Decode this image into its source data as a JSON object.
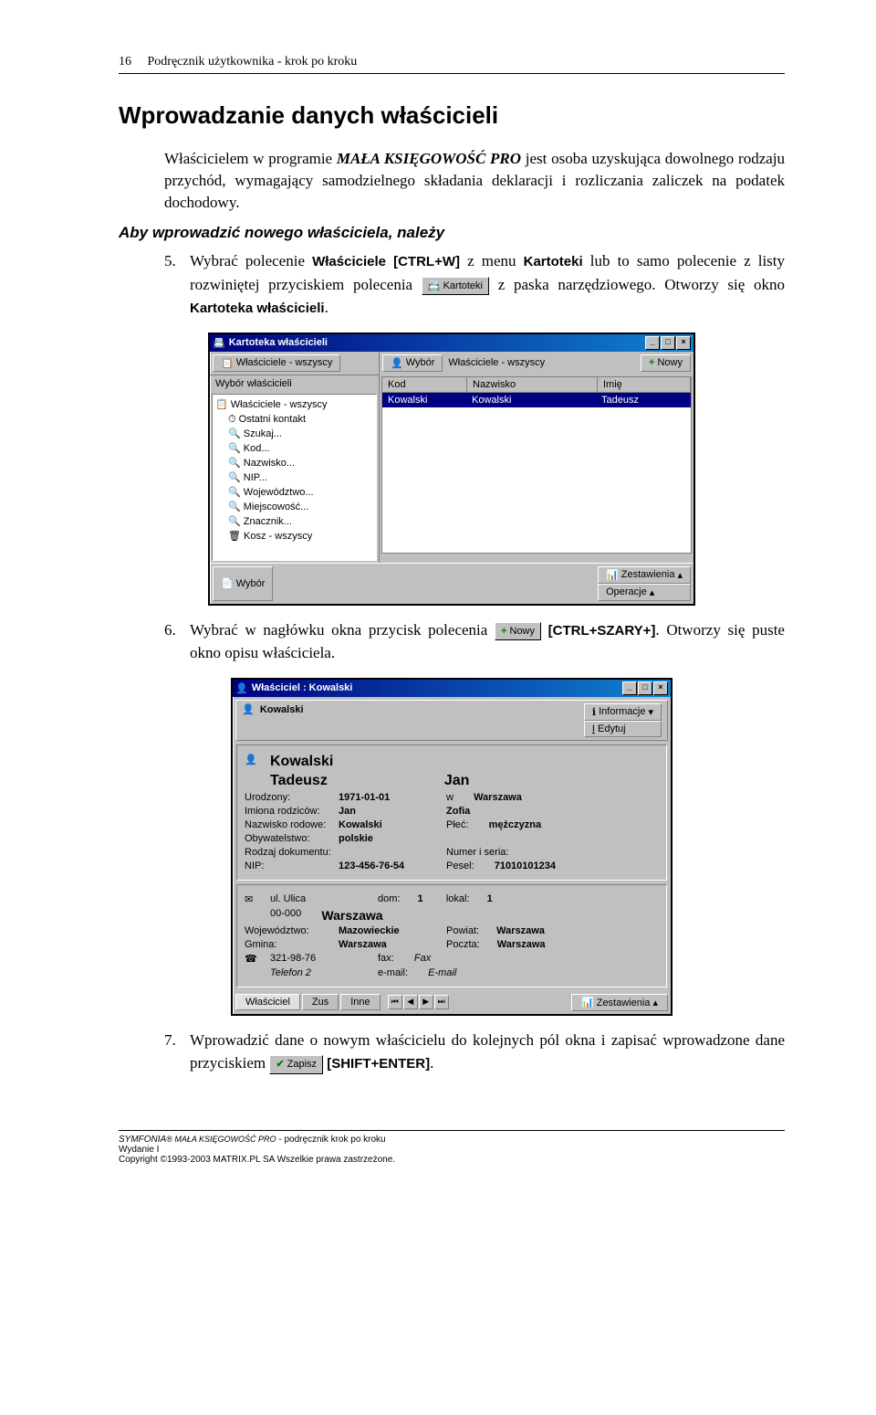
{
  "header": {
    "page_num": "16",
    "title": "Podręcznik użytkownika - krok po kroku"
  },
  "section_title": "Wprowadzanie danych właścicieli",
  "intro": {
    "pre": "Właścicielem w programie ",
    "prog": "MAŁA KSIĘGOWOŚĆ PRO",
    "post": " jest osoba uzyskująca dowolnego rodzaju przychód, wymagający samodzielnego składania deklaracji i rozliczania zaliczek na podatek dochodowy."
  },
  "subhead": "Aby wprowadzić nowego właściciela, należy",
  "step5": {
    "n": "5.",
    "a": "Wybrać polecenie ",
    "cmd": "Właściciele",
    "key": "[CTRL+W]",
    "b": " z menu ",
    "menu": "Kartoteki",
    "c": " lub to samo polecenie z listy rozwiniętej przyciskiem polecenia ",
    "btn": "Kartoteki",
    "d": " z paska narzędziowego. Otworzy się okno ",
    "win": "Kartoteka właścicieli",
    "e": "."
  },
  "win1": {
    "title": "Kartoteka właścicieli",
    "left_hdr": "Właściciele - wszyscy",
    "left_sub": "Wybór właścicieli",
    "tree_root": "Właściciele - wszyscy",
    "tree_items": [
      "Ostatni kontakt",
      "Szukaj...",
      "Kod...",
      "Nazwisko...",
      "NIP...",
      "Województwo...",
      "Miejscowość...",
      "Znacznik...",
      "Kosz - wszyscy"
    ],
    "tb_wybor": "Wybór",
    "tb_desc": "Właściciele - wszyscy",
    "tb_nowy": "Nowy",
    "col_kod": "Kod",
    "col_nazw": "Nazwisko",
    "col_imie": "Imię",
    "row_kod": "Kowalski",
    "row_nazw": "Kowalski",
    "row_imie": "Tadeusz",
    "sb_wybor": "Wybór",
    "sb_zest": "Zestawienia",
    "sb_oper": "Operacje"
  },
  "step6": {
    "n": "6.",
    "a": "Wybrać w nagłówku okna przycisk polecenia ",
    "btn": "Nowy",
    "key": " [CTRL+SZARY+]",
    "b": ". Otworzy się puste okno opisu właściciela."
  },
  "win2": {
    "title": "Właściciel : Kowalski",
    "name_top": "Kowalski",
    "btn_info": "Informacje",
    "btn_edit": "Edytuj",
    "big1": "Kowalski",
    "big2": "Tadeusz",
    "big3": "Jan",
    "l_urodz": "Urodzony:",
    "v_urodz": "1971-01-01",
    "l_w": "w",
    "v_w": "Warszawa",
    "l_imrodz": "Imiona rodziców:",
    "v_jan": "Jan",
    "v_zofia": "Zofia",
    "l_nazrod": "Nazwisko rodowe:",
    "v_nazrod": "Kowalski",
    "l_plec": "Płeć:",
    "v_plec": "mężczyzna",
    "l_obyw": "Obywatelstwo:",
    "v_obyw": "polskie",
    "l_rodzdok": "Rodzaj dokumentu:",
    "l_numser": "Numer i seria:",
    "l_nip": "NIP:",
    "v_nip": "123-456-76-54",
    "l_pesel": "Pesel:",
    "v_pesel": "71010101234",
    "v_ul": "ul. Ulica",
    "l_dom": "dom:",
    "v_dom": "1",
    "l_lokal": "lokal:",
    "v_lokal": "1",
    "v_kod": "00-000",
    "v_miasto": "Warszawa",
    "l_woj": "Województwo:",
    "v_woj": "Mazowieckie",
    "l_pow": "Powiat:",
    "v_pow": "Warszawa",
    "l_gmina": "Gmina:",
    "v_gmina": "Warszawa",
    "l_poczta": "Poczta:",
    "v_poczta": "Warszawa",
    "v_tel": "321-98-76",
    "l_fax": "fax:",
    "v_fax": "Fax",
    "v_tel2": "Telefon 2",
    "l_email": "e-mail:",
    "v_email": "E-mail",
    "tab_wl": "Właściciel",
    "tab_zus": "Zus",
    "tab_inne": "Inne",
    "tab_zest": "Zestawienia"
  },
  "step7": {
    "n": "7.",
    "a": "Wprowadzić dane o nowym właścicielu do kolejnych pól okna i zapisać wprowadzone dane przyciskiem ",
    "btn": "Zapisz",
    "key": " [SHIFT+ENTER]",
    "b": "."
  },
  "footer": {
    "l1a": "SYMFONIA",
    "l1b": "® MAŁA KSIĘGOWOŚĆ PRO",
    "l1c": " - podręcznik krok po kroku",
    "l2": "Wydanie I",
    "l3": "Copyright ©1993-2003 MATRIX.PL SA Wszelkie prawa zastrzeżone."
  }
}
